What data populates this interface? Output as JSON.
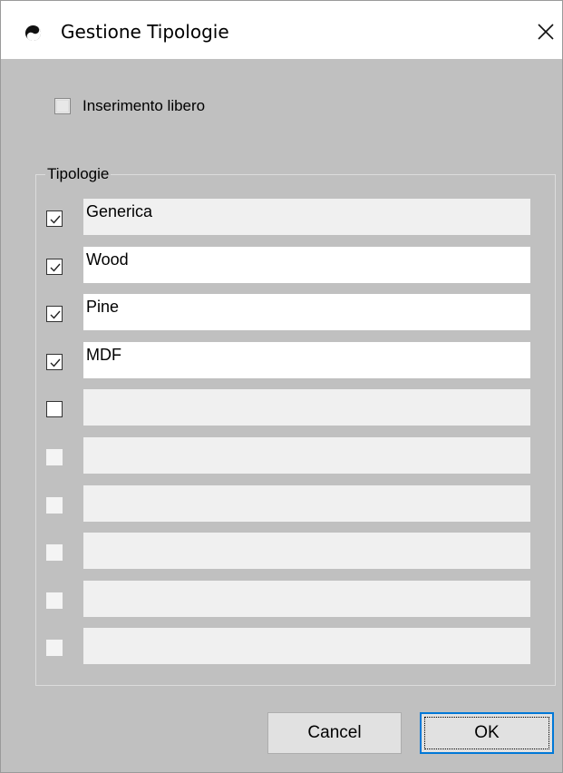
{
  "window": {
    "title": "Gestione Tipologie",
    "close_symbol": "✕",
    "app_icon": "yin-yang-icon"
  },
  "free_entry": {
    "label": "Inserimento libero",
    "checked": false
  },
  "group": {
    "label": "Tipologie",
    "rows": [
      {
        "checked": true,
        "enabled": true,
        "text": "Generica",
        "editable": false
      },
      {
        "checked": true,
        "enabled": true,
        "text": "Wood",
        "editable": true
      },
      {
        "checked": true,
        "enabled": true,
        "text": "Pine",
        "editable": true
      },
      {
        "checked": true,
        "enabled": true,
        "text": "MDF",
        "editable": true
      },
      {
        "checked": false,
        "enabled": true,
        "text": "",
        "editable": false
      },
      {
        "checked": false,
        "enabled": false,
        "text": "",
        "editable": false
      },
      {
        "checked": false,
        "enabled": false,
        "text": "",
        "editable": false
      },
      {
        "checked": false,
        "enabled": false,
        "text": "",
        "editable": false
      },
      {
        "checked": false,
        "enabled": false,
        "text": "",
        "editable": false
      },
      {
        "checked": false,
        "enabled": false,
        "text": "",
        "editable": false
      }
    ]
  },
  "buttons": {
    "cancel_label": "Cancel",
    "ok_label": "OK"
  },
  "colors": {
    "client_background": "#c0c0c0",
    "default_button_border": "#0078d7"
  }
}
